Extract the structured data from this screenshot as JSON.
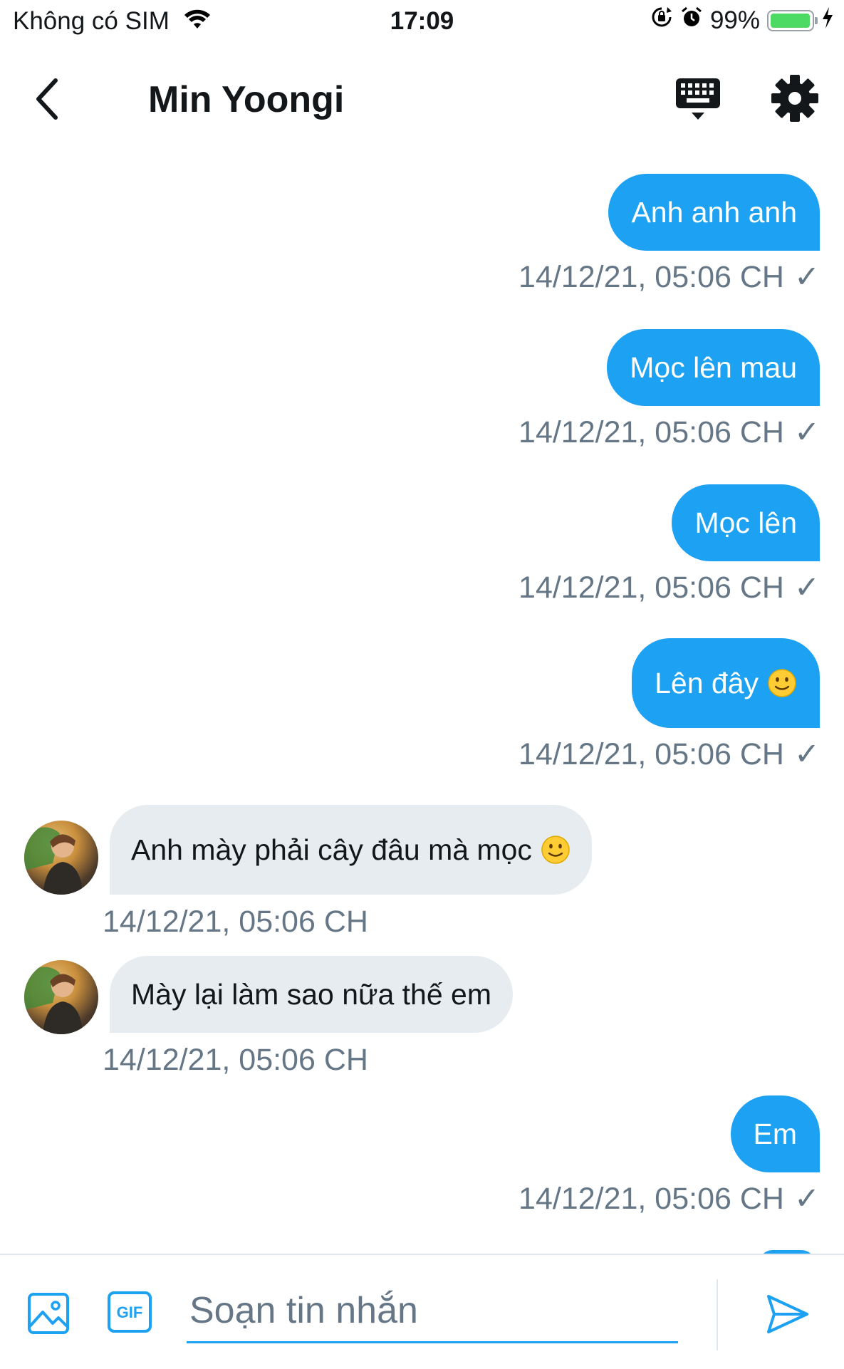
{
  "status_bar": {
    "carrier": "Không có SIM",
    "time": "17:09",
    "battery_text": "99%",
    "battery_level": 0.99
  },
  "header": {
    "title": "Min Yoongi",
    "back_icon": "chevron-left-icon",
    "keyboard_icon": "keyboard-icon",
    "settings_icon": "gear-icon"
  },
  "colors": {
    "accent": "#1da1f2",
    "incoming_bubble": "#e6ecf0",
    "timestamp": "#657786"
  },
  "messages": [
    {
      "direction": "out",
      "text": "Anh anh anh",
      "timestamp": "14/12/21, 05:06 CH",
      "read_mark": "✓"
    },
    {
      "direction": "out",
      "text": "Mọc lên mau",
      "timestamp": "14/12/21, 05:06 CH",
      "read_mark": "✓"
    },
    {
      "direction": "out",
      "text": "Mọc lên",
      "timestamp": "14/12/21, 05:06 CH",
      "read_mark": "✓"
    },
    {
      "direction": "out",
      "text": "Lên đây",
      "emoji": "slightly-smiling-face",
      "timestamp": "14/12/21, 05:06 CH",
      "read_mark": "✓"
    },
    {
      "direction": "in",
      "text": "Anh mày phải cây đâu mà mọc",
      "emoji": "slightly-smiling-face",
      "timestamp": "14/12/21, 05:06 CH"
    },
    {
      "direction": "in",
      "text": "Mày lại làm sao nữa thế em",
      "timestamp": "14/12/21, 05:06 CH"
    },
    {
      "direction": "out",
      "text": "Em",
      "timestamp": "14/12/21, 05:06 CH",
      "read_mark": "✓"
    }
  ],
  "composer": {
    "placeholder": "Soạn tin nhắn",
    "image_icon": "image-icon",
    "gif_icon": "gif-icon",
    "gif_label": "GIF",
    "send_icon": "send-icon"
  }
}
